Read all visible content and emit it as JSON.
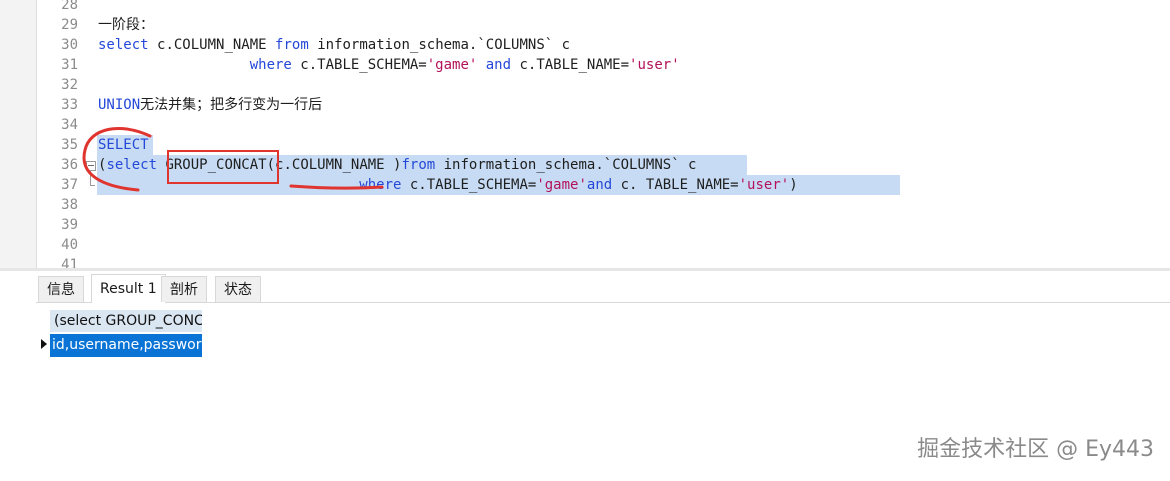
{
  "editor": {
    "lines": [
      {
        "n": "28",
        "text": ""
      },
      {
        "n": "29",
        "text": "一阶段："
      },
      {
        "n": "30",
        "parts": [
          {
            "t": "select ",
            "c": "kw"
          },
          {
            "t": "c.COLUMN_NAME ",
            "c": ""
          },
          {
            "t": "from ",
            "c": "kw"
          },
          {
            "t": "information_schema.`COLUMNS` c",
            "c": ""
          }
        ]
      },
      {
        "n": "31",
        "parts": [
          {
            "t": "                  where ",
            "c": "kw"
          },
          {
            "t": "c.TABLE_SCHEMA=",
            "c": ""
          },
          {
            "t": "'game'",
            "c": "str"
          },
          {
            "t": " and ",
            "c": "kw"
          },
          {
            "t": "c.TABLE_NAME=",
            "c": ""
          },
          {
            "t": "'user'",
            "c": "str"
          }
        ]
      },
      {
        "n": "32",
        "text": ""
      },
      {
        "n": "33",
        "parts": [
          {
            "t": "UNION",
            "c": "kw"
          },
          {
            "t": "无法并集；把多行变为一行后",
            "c": "cjk"
          }
        ]
      },
      {
        "n": "34",
        "text": ""
      },
      {
        "n": "35",
        "parts": [
          {
            "t": "SELECT",
            "c": "kw"
          }
        ]
      },
      {
        "n": "36",
        "parts": [
          {
            "t": "(",
            "c": ""
          },
          {
            "t": "select ",
            "c": "kw"
          },
          {
            "t": "GROUP_CONCAT",
            "c": ""
          },
          {
            "t": "(c.COLUMN_NAME )",
            "c": ""
          },
          {
            "t": "from ",
            "c": "kw"
          },
          {
            "t": "information_schema.`COLUMNS` c",
            "c": ""
          }
        ]
      },
      {
        "n": "37",
        "parts": [
          {
            "t": "                               where ",
            "c": "kw"
          },
          {
            "t": "c.TABLE_SCHEMA=",
            "c": ""
          },
          {
            "t": "'game'",
            "c": "str"
          },
          {
            "t": "and ",
            "c": "kw"
          },
          {
            "t": "c. TABLE_NAME=",
            "c": ""
          },
          {
            "t": "'user'",
            "c": "str"
          },
          {
            "t": ")",
            "c": ""
          }
        ]
      },
      {
        "n": "38",
        "text": ""
      },
      {
        "n": "39",
        "text": ""
      },
      {
        "n": "40",
        "text": ""
      },
      {
        "n": "41",
        "text": ""
      }
    ]
  },
  "tabs": [
    {
      "label": "信息"
    },
    {
      "label": "Result 1"
    },
    {
      "label": "剖析"
    },
    {
      "label": "状态"
    }
  ],
  "results": {
    "column_header": "(select GROUP_CONCAT(c.COLUMN_NAME )from information_schema.`COLUMNS` c",
    "cell_value": "id,username,password"
  },
  "watermark": "掘金技术社区 @ Ey443",
  "colors": {
    "keyword": "#2448d8",
    "string": "#b3125a",
    "selection": "#c7dcf4",
    "annotation": "#e0342f",
    "selected_cell": "#0a74d6"
  }
}
